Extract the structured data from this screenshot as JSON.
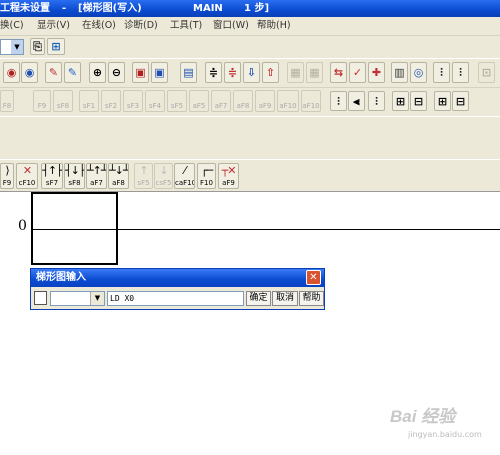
{
  "window": {
    "title_prefix": "工程未设置",
    "title_dash": "-",
    "title_view": "[梯形图(写入)",
    "title_program": "MAIN",
    "title_steps": "1 步]"
  },
  "menubar": {
    "items": [
      "换(C)",
      "显示(V)",
      "在线(O)",
      "诊断(D)",
      "工具(T)",
      "窗口(W)",
      "帮助(H)"
    ]
  },
  "toolbar_row3": {
    "fkeys": [
      "F8",
      "F9",
      "sF8",
      "sF1",
      "sF2",
      "sF3",
      "sF4",
      "sF5",
      "aF5",
      "aF7",
      "aF8",
      "aF9",
      "aF10",
      "aF10"
    ]
  },
  "toolbar_row5": {
    "fkeys": [
      "F9",
      "cF10",
      "sF7",
      "sF8",
      "aF7",
      "aF8",
      "sF5",
      "csF5",
      "caF10",
      "F10",
      "aF9"
    ]
  },
  "ladder": {
    "step_number": "0"
  },
  "dialog": {
    "title": "梯形图输入",
    "close_glyph": "✕",
    "instruction_value": "LD X0",
    "ok_label": "确定",
    "cancel_label": "取消",
    "help_label": "帮助"
  },
  "watermark": {
    "text": "Bai 经验",
    "sub": "jingyan.baidu.com"
  }
}
